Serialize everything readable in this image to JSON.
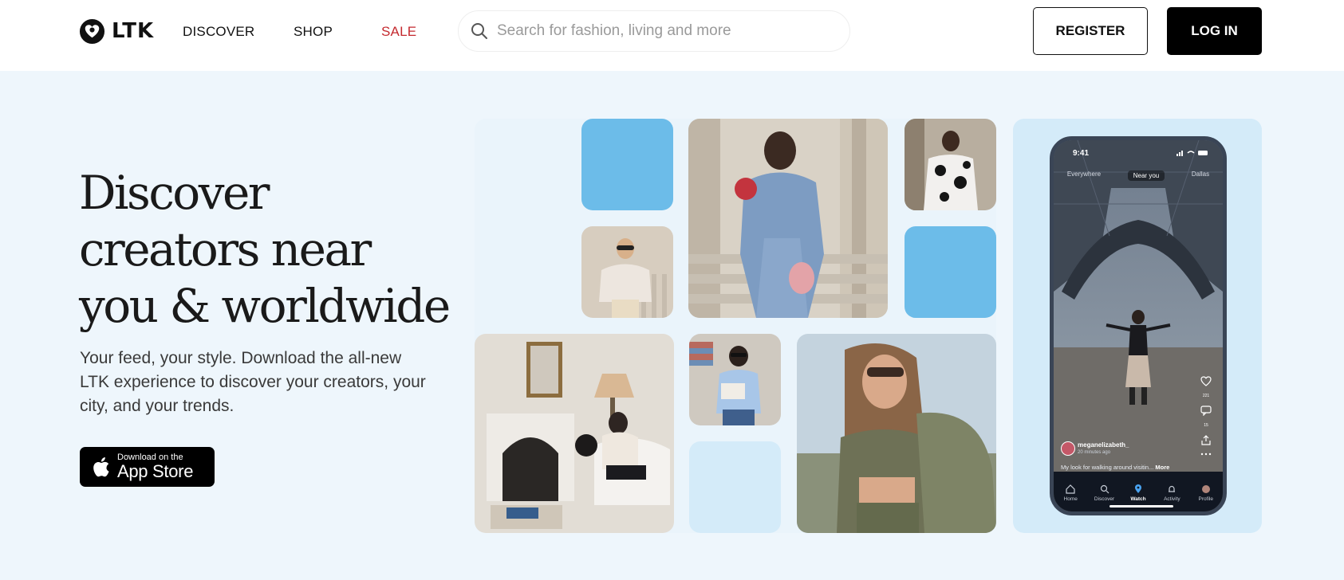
{
  "header": {
    "logo_text": "LTK",
    "nav": {
      "discover": "DISCOVER",
      "shop": "SHOP",
      "sale": "SALE"
    },
    "search_placeholder": "Search for fashion, living and more",
    "register_label": "REGISTER",
    "login_label": "LOG IN"
  },
  "hero": {
    "title": "Discover creators near you & worldwide",
    "subtitle": "Your feed, your style. Download the all-new LTK experience to discover your creators, your city, and your trends.",
    "app_store": {
      "small": "Download on the",
      "big": "App Store"
    }
  },
  "phone": {
    "time": "9:41",
    "tabs": [
      "Everywhere",
      "Near you",
      "Dallas"
    ],
    "active_tab": "Near you",
    "username": "meganelizabeth_",
    "posted_ago": "20 minutes ago",
    "caption": "My look for walking around visitin...",
    "caption_more": "More",
    "action_counts": [
      "221",
      "15"
    ],
    "navbar": [
      "Home",
      "Discover",
      "Watch",
      "Activity",
      "Profile"
    ],
    "active_nav": "Watch"
  },
  "colors": {
    "accent_sale": "#c42a2f",
    "hero_background": "#eef6fc",
    "tile_blue": "#6cbce9",
    "tile_pale": "#d4ebf9",
    "button_dark": "#000000"
  },
  "icons": {
    "logo": "ltk-heart-logo-icon",
    "search": "search-icon",
    "apple": "apple-icon"
  }
}
